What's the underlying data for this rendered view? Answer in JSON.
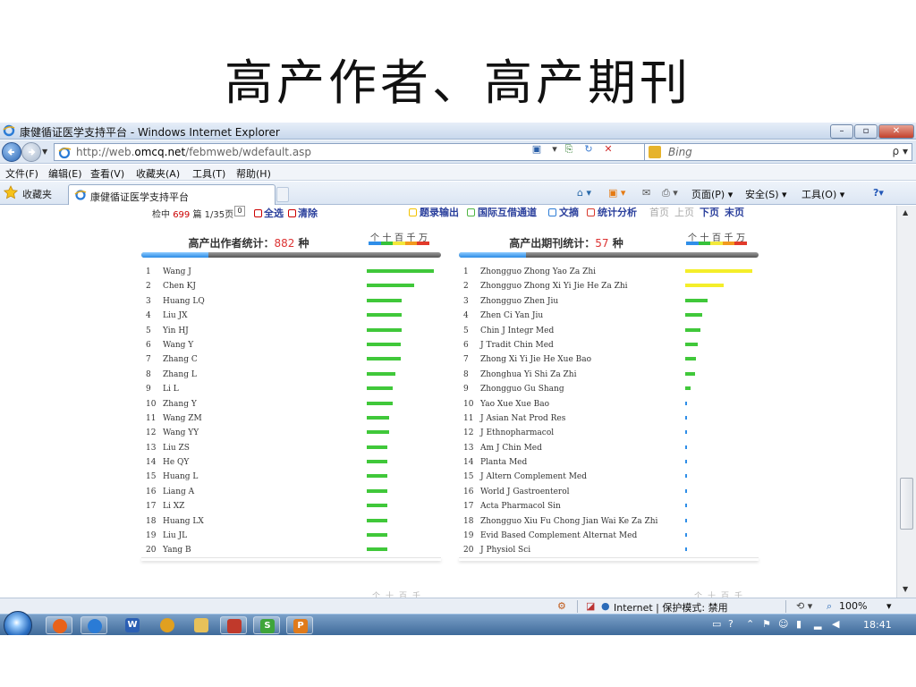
{
  "slide": {
    "title": "高产作者、高产期刊"
  },
  "window": {
    "title": "康健循证医学支持平台 - Windows Internet Explorer",
    "min": "–",
    "max": "▫",
    "close": "✕"
  },
  "address": {
    "url_prefix": "http://web.",
    "url_host": "omcq.net",
    "url_path": "/febmweb/wdefault.asp"
  },
  "search": {
    "placeholder": "Bing",
    "go": "ρ ▾"
  },
  "menu": [
    "文件(F)",
    "编辑(E)",
    "查看(V)",
    "收藏夹(A)",
    "工具(T)",
    "帮助(H)"
  ],
  "favorites": {
    "label": "收藏夹"
  },
  "tab": {
    "label": "康健循证医学支持平台"
  },
  "commandbar": {
    "page": "页面(P) ▾",
    "safety": "安全(S) ▾",
    "tools": "工具(O) ▾",
    "help": "?▾"
  },
  "toolbar": {
    "hits_prefix": "检中",
    "hits_count": "699",
    "hits_suffix": "篇 1/35页",
    "page_value": "0",
    "select_all": "全选",
    "clear": "清除",
    "actions": [
      {
        "label": "题录输出",
        "color": "#f2c200"
      },
      {
        "label": "国际互借通道",
        "color": "#4fb543"
      },
      {
        "label": "文摘",
        "color": "#2f7dd6"
      },
      {
        "label": "统计分析",
        "color": "#d83a2e"
      }
    ],
    "first_page": "首页",
    "prev_page": "上页",
    "next_page": "下页",
    "last_page": "末页"
  },
  "scale": {
    "ticks": [
      "个",
      "十",
      "百",
      "千",
      "万"
    ],
    "colors": [
      "#2f8ee8",
      "#36c23a",
      "#f3e83a",
      "#f29a1e",
      "#e23a2a"
    ]
  },
  "authors": {
    "title_label": "高产出作者统计：",
    "count": "882",
    "unit": " 种",
    "bar_color": "#40c83a",
    "rows": [
      {
        "rank": "1",
        "name": "Wang J",
        "value": 1.0
      },
      {
        "rank": "2",
        "name": "Chen KJ",
        "value": 0.7
      },
      {
        "rank": "3",
        "name": "Huang LQ",
        "value": 0.52
      },
      {
        "rank": "4",
        "name": "Liu JX",
        "value": 0.52
      },
      {
        "rank": "5",
        "name": "Yin HJ",
        "value": 0.52
      },
      {
        "rank": "6",
        "name": "Wang Y",
        "value": 0.51
      },
      {
        "rank": "7",
        "name": "Zhang C",
        "value": 0.51
      },
      {
        "rank": "8",
        "name": "Zhang L",
        "value": 0.43
      },
      {
        "rank": "9",
        "name": "Li L",
        "value": 0.39
      },
      {
        "rank": "10",
        "name": "Zhang Y",
        "value": 0.39
      },
      {
        "rank": "11",
        "name": "Wang ZM",
        "value": 0.33
      },
      {
        "rank": "12",
        "name": "Wang YY",
        "value": 0.33
      },
      {
        "rank": "13",
        "name": "Liu ZS",
        "value": 0.31
      },
      {
        "rank": "14",
        "name": "He QY",
        "value": 0.31
      },
      {
        "rank": "15",
        "name": "Huang L",
        "value": 0.31
      },
      {
        "rank": "16",
        "name": "Liang A",
        "value": 0.31
      },
      {
        "rank": "17",
        "name": "Li XZ",
        "value": 0.3
      },
      {
        "rank": "18",
        "name": "Huang LX",
        "value": 0.3
      },
      {
        "rank": "19",
        "name": "Liu JL",
        "value": 0.3
      },
      {
        "rank": "20",
        "name": "Yang B",
        "value": 0.3
      }
    ]
  },
  "journals": {
    "title_label": "高产出期刊统计：",
    "count": "57",
    "unit": " 种",
    "rows": [
      {
        "rank": "1",
        "name": "Zhongguo Zhong Yao Za Zhi",
        "value": 1.0,
        "color": "#f4ee2a"
      },
      {
        "rank": "2",
        "name": "Zhongguo Zhong Xi Yi Jie He Za Zhi",
        "value": 0.57,
        "color": "#f4ee2a"
      },
      {
        "rank": "3",
        "name": "Zhongguo Zhen Jiu",
        "value": 0.33,
        "color": "#40c83a"
      },
      {
        "rank": "4",
        "name": "Zhen Ci Yan Jiu",
        "value": 0.25,
        "color": "#40c83a"
      },
      {
        "rank": "5",
        "name": "Chin J Integr Med",
        "value": 0.23,
        "color": "#40c83a"
      },
      {
        "rank": "6",
        "name": "J Tradit Chin Med",
        "value": 0.19,
        "color": "#40c83a"
      },
      {
        "rank": "7",
        "name": "Zhong Xi Yi Jie He Xue Bao",
        "value": 0.16,
        "color": "#40c83a"
      },
      {
        "rank": "8",
        "name": "Zhonghua Yi Shi Za Zhi",
        "value": 0.15,
        "color": "#40c83a"
      },
      {
        "rank": "9",
        "name": "Zhongguo Gu Shang",
        "value": 0.08,
        "color": "#40c83a"
      },
      {
        "rank": "10",
        "name": "Yao Xue Xue Bao",
        "value": 0.03,
        "color": "#2f8ee8"
      },
      {
        "rank": "11",
        "name": "J Asian Nat Prod Res",
        "value": 0.015,
        "color": "#2f8ee8"
      },
      {
        "rank": "12",
        "name": "J Ethnopharmacol",
        "value": 0.015,
        "color": "#2f8ee8"
      },
      {
        "rank": "13",
        "name": "Am J Chin Med",
        "value": 0.013,
        "color": "#2f8ee8"
      },
      {
        "rank": "14",
        "name": "Planta Med",
        "value": 0.012,
        "color": "#2f8ee8"
      },
      {
        "rank": "15",
        "name": "J Altern Complement Med",
        "value": 0.012,
        "color": "#2f8ee8"
      },
      {
        "rank": "16",
        "name": "World J Gastroenterol",
        "value": 0.012,
        "color": "#2f8ee8"
      },
      {
        "rank": "17",
        "name": "Acta Pharmacol Sin",
        "value": 0.012,
        "color": "#2f8ee8"
      },
      {
        "rank": "18",
        "name": "Zhongguo Xiu Fu Chong Jian Wai Ke Za Zhi",
        "value": 0.012,
        "color": "#2f8ee8"
      },
      {
        "rank": "19",
        "name": "Evid Based Complement Alternat Med",
        "value": 0.012,
        "color": "#2f8ee8"
      },
      {
        "rank": "20",
        "name": "J Physiol Sci",
        "value": 0.012,
        "color": "#2f8ee8"
      }
    ]
  },
  "statusbar": {
    "zone": "Internet | 保护模式: 禁用",
    "zoom": "100%",
    "zoom_arrow": "▾"
  },
  "taskbar": {
    "clock": "18:41"
  }
}
